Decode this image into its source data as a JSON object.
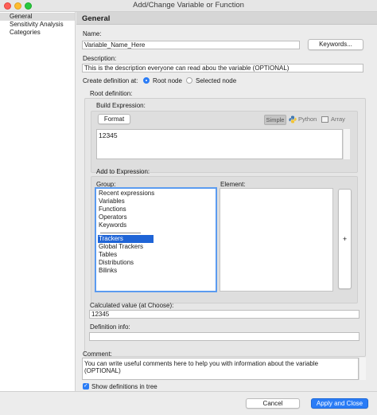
{
  "window": {
    "title": "Add/Change Variable or Function"
  },
  "sidebar": {
    "items": [
      {
        "label": "General",
        "selected": true
      },
      {
        "label": "Sensitivity Analysis",
        "selected": false
      },
      {
        "label": "Categories",
        "selected": false
      }
    ]
  },
  "header": {
    "title": "General"
  },
  "name": {
    "label": "Name:",
    "value": "Variable_Name_Here",
    "keywords_button": "Keywords..."
  },
  "description": {
    "label": "Description:",
    "value": "This is the description everyone can read abou the variable (OPTIONAL)"
  },
  "create_definition": {
    "label": "Create definition at:",
    "options": [
      {
        "label": "Root node",
        "selected": true
      },
      {
        "label": "Selected node",
        "selected": false
      }
    ]
  },
  "root_definition": {
    "label": "Root definition:",
    "build_expression_label": "Build Expression:",
    "format_button": "Format",
    "modes": [
      "Simple",
      "Python",
      "Array"
    ],
    "active_mode": "Simple",
    "expression": "12345"
  },
  "add_to_expression": {
    "label": "Add to Expression:",
    "group_label": "Group:",
    "element_label": "Element:",
    "groups_top": [
      "Recent expressions",
      "Variables",
      "Functions",
      "Operators",
      "Keywords"
    ],
    "groups_bottom": [
      "Trackers",
      "Global Trackers",
      "Tables",
      "Distributions",
      "Bilinks"
    ],
    "selected_group": "Trackers",
    "add_button": "+"
  },
  "calculated": {
    "label": "Calculated value (at Choose):",
    "value": "12345"
  },
  "definition_info": {
    "label": "Definition info:",
    "value": ""
  },
  "comment": {
    "label": "Comment:",
    "value": "You can write useful comments here to help you with information about the variable (OPTIONAL)"
  },
  "show_definitions": {
    "label": "Show definitions in tree",
    "checked": true
  },
  "footer": {
    "cancel_button": "Cancel",
    "apply_button": "Apply and Close"
  },
  "colors": {
    "accent": "#2a7cf6",
    "selection": "#1f64d6"
  }
}
